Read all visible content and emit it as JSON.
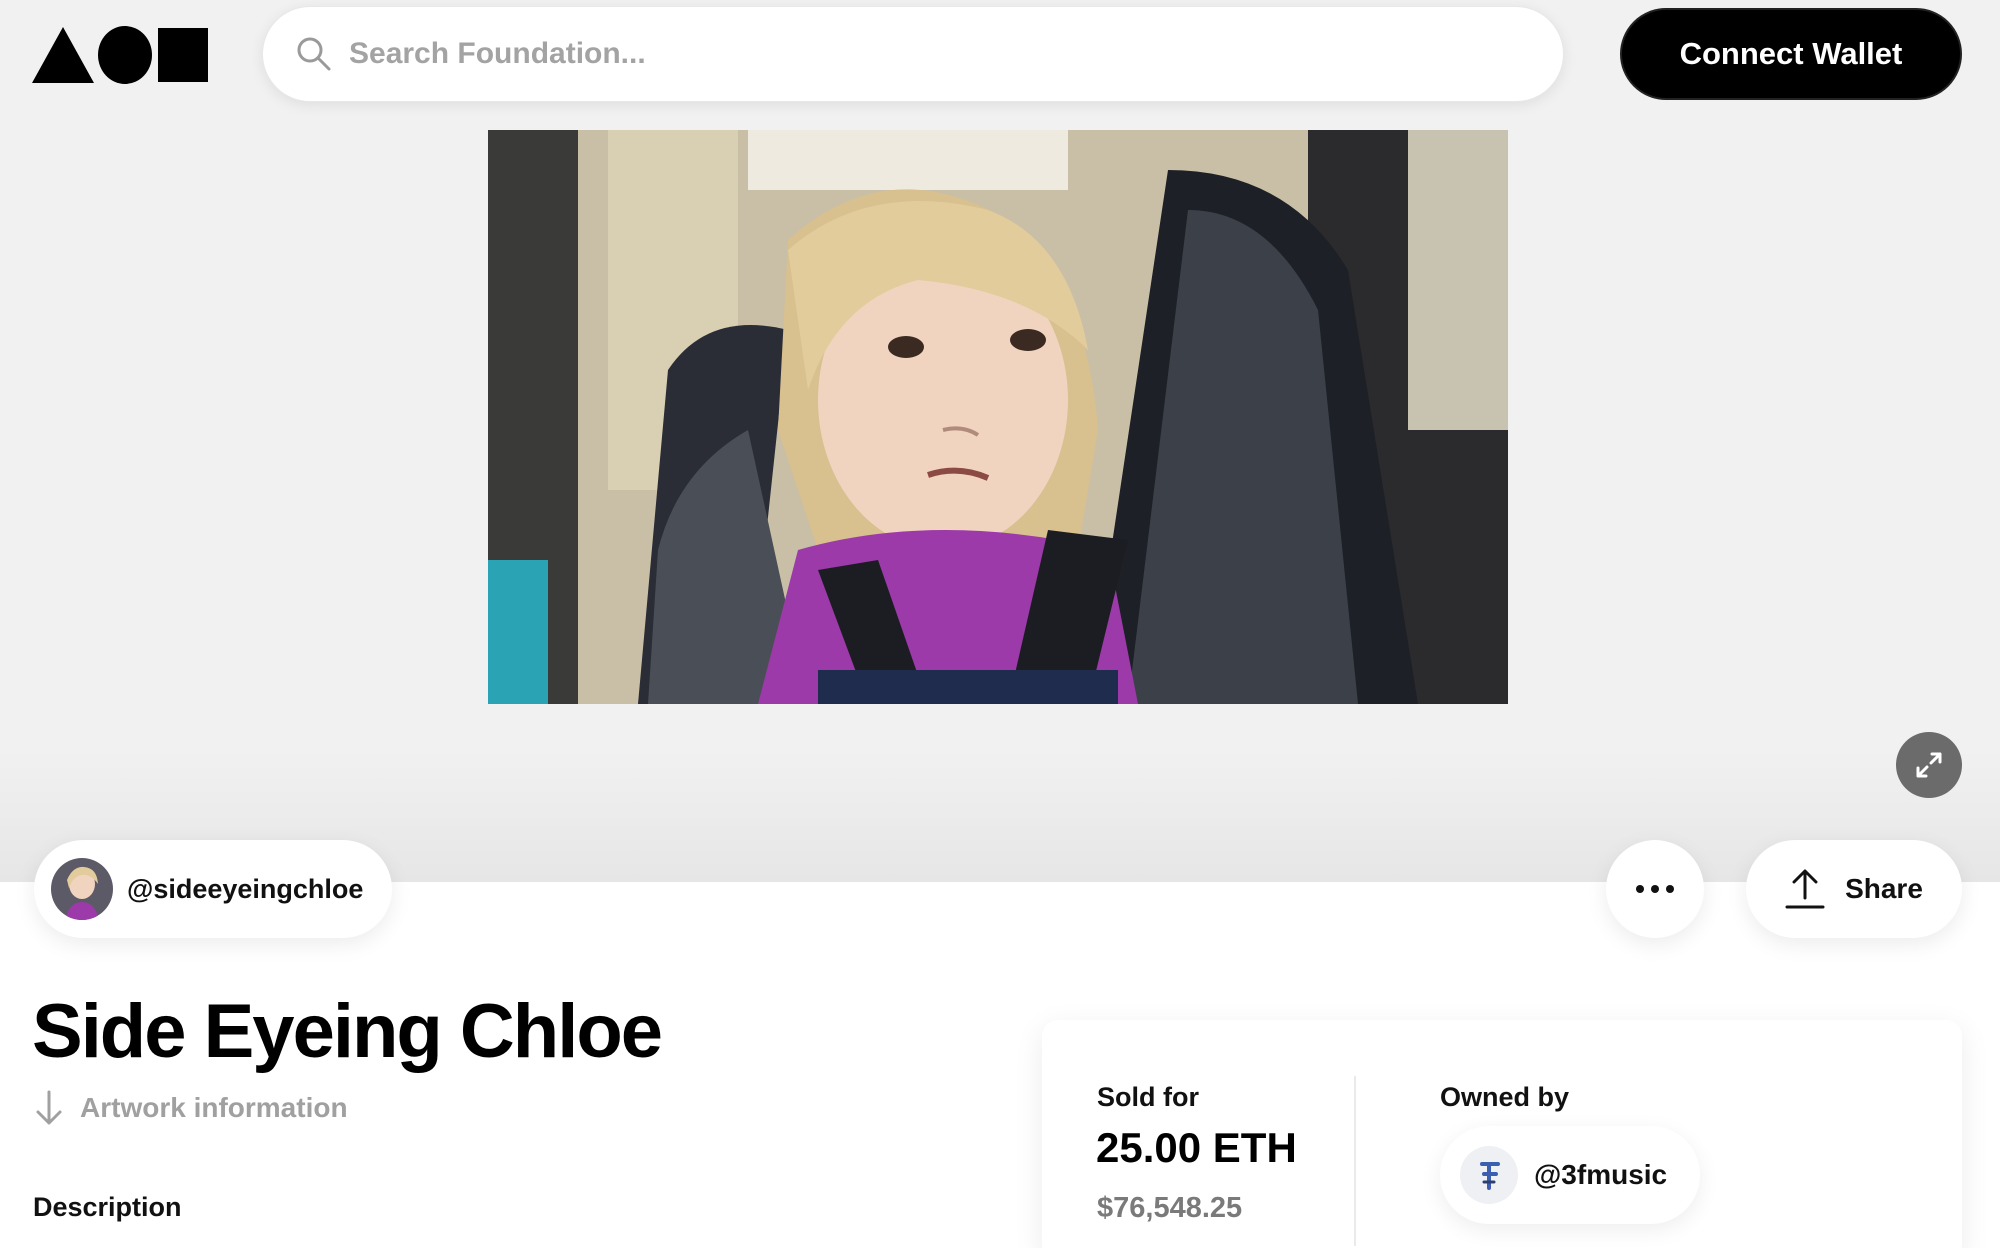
{
  "header": {
    "logo_icons": [
      "triangle-icon",
      "circle-icon",
      "square-icon"
    ],
    "search": {
      "placeholder": "Search Foundation...",
      "value": ""
    },
    "connect_wallet_label": "Connect Wallet"
  },
  "artwork": {
    "subject": "young girl in car seat side-eye"
  },
  "creator": {
    "username": "@sideeyeingchloe"
  },
  "actions": {
    "share_label": "Share"
  },
  "main": {
    "title": "Side Eyeing Chloe",
    "artwork_info_label": "Artwork information",
    "description_heading": "Description"
  },
  "sale": {
    "sold_label": "Sold for",
    "price_eth": "25.00 ETH",
    "price_usd": "$76,548.25",
    "owned_label": "Owned by",
    "owner": "@3fmusic"
  },
  "colors": {
    "hero_bg": "#f1f1f1",
    "button_dark": "#000000",
    "muted_text": "#a0a0a0",
    "expand_btn": "#6b6b6b"
  }
}
